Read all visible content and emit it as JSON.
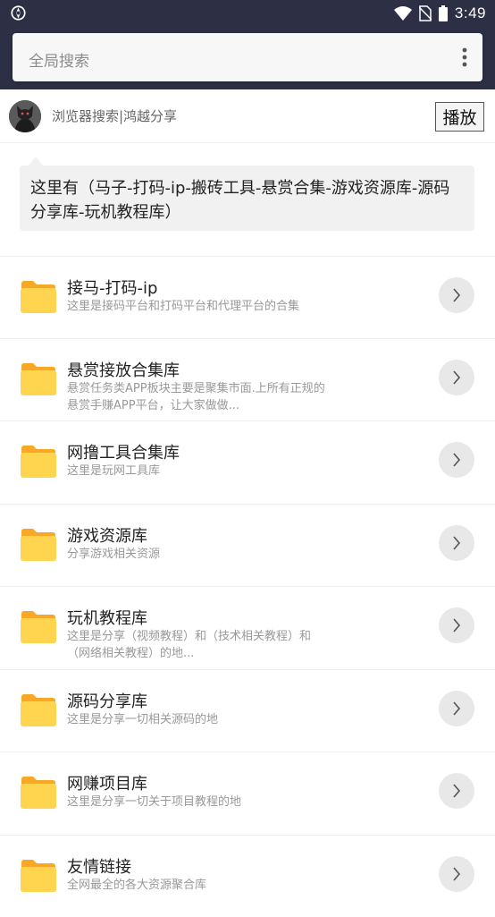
{
  "status_bar": {
    "time": "3:49",
    "icons": [
      "app-notification-icon",
      "wifi-icon",
      "no-sim-icon",
      "battery-icon"
    ]
  },
  "search": {
    "placeholder": "全局搜索",
    "menu_icon": "more-vert-icon"
  },
  "header": {
    "title": "浏览器搜索|鸿越分享",
    "play_label": "播放"
  },
  "intro": {
    "text": "这里有（马子-打码-ip-搬砖工具-悬赏合集-游戏资源库-源码分享库-玩机教程库）"
  },
  "list": {
    "items": [
      {
        "title": "接马-打码-ip",
        "desc": "这里是接码平台和打码平台和代理平台的合集"
      },
      {
        "title": "悬赏接放合集库",
        "desc": "悬赏任务类APP板块主要是聚集市面.上所有正规的悬赏手赚APP平台，让大家做做..."
      },
      {
        "title": "网撸工具合集库",
        "desc": "这里是玩网工具库"
      },
      {
        "title": "游戏资源库",
        "desc": "分享游戏相关资源"
      },
      {
        "title": "玩机教程库",
        "desc": "这里是分享（视频教程）和（技术相关教程）和（网络相关教程）的地..."
      },
      {
        "title": "源码分享库",
        "desc": "这里是分享一切相关源码的地"
      },
      {
        "title": "网赚项目库",
        "desc": "这里是分享一切关于项目教程的地"
      },
      {
        "title": "友情链接",
        "desc": "全网最全的各大资源聚合库"
      }
    ]
  },
  "colors": {
    "topbar": "#2d2f45",
    "folder": "#ffd54f",
    "folder_tab": "#f9a825"
  }
}
